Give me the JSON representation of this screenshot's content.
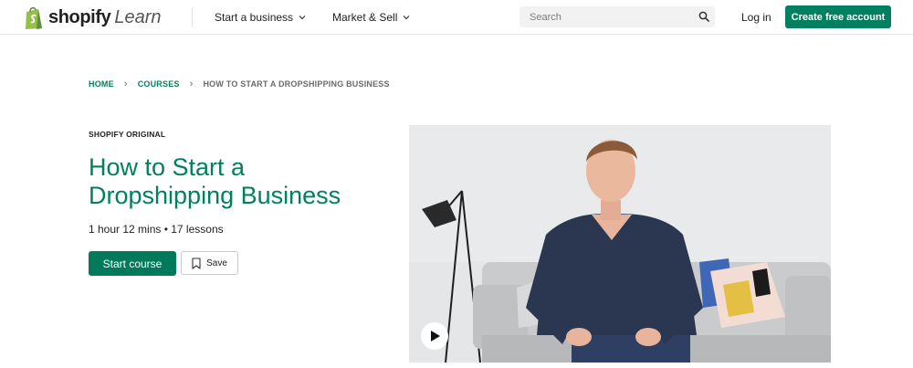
{
  "header": {
    "logo_word": "shopify",
    "logo_suffix": "Learn",
    "nav": [
      {
        "label": "Start a business",
        "icon": "chevron-down-icon"
      },
      {
        "label": "Market & Sell",
        "icon": "chevron-down-icon"
      }
    ],
    "search_placeholder": "Search",
    "login_label": "Log in",
    "cta_label": "Create free account"
  },
  "breadcrumb": {
    "items": [
      "HOME",
      "COURSES",
      "HOW TO START A DROPSHIPPING BUSINESS"
    ],
    "separator_icon": "chevron-right-icon"
  },
  "course": {
    "eyebrow": "SHOPIFY ORIGINAL",
    "title": "How to Start a Dropshipping Business",
    "meta": "1 hour 12 mins • 17 lessons",
    "start_label": "Start course",
    "save_label": "Save",
    "save_icon": "bookmark-icon"
  },
  "video": {
    "play_icon": "play-icon"
  },
  "colors": {
    "brand_green": "#008060",
    "text": "#212326",
    "muted": "#6b6b6b"
  }
}
